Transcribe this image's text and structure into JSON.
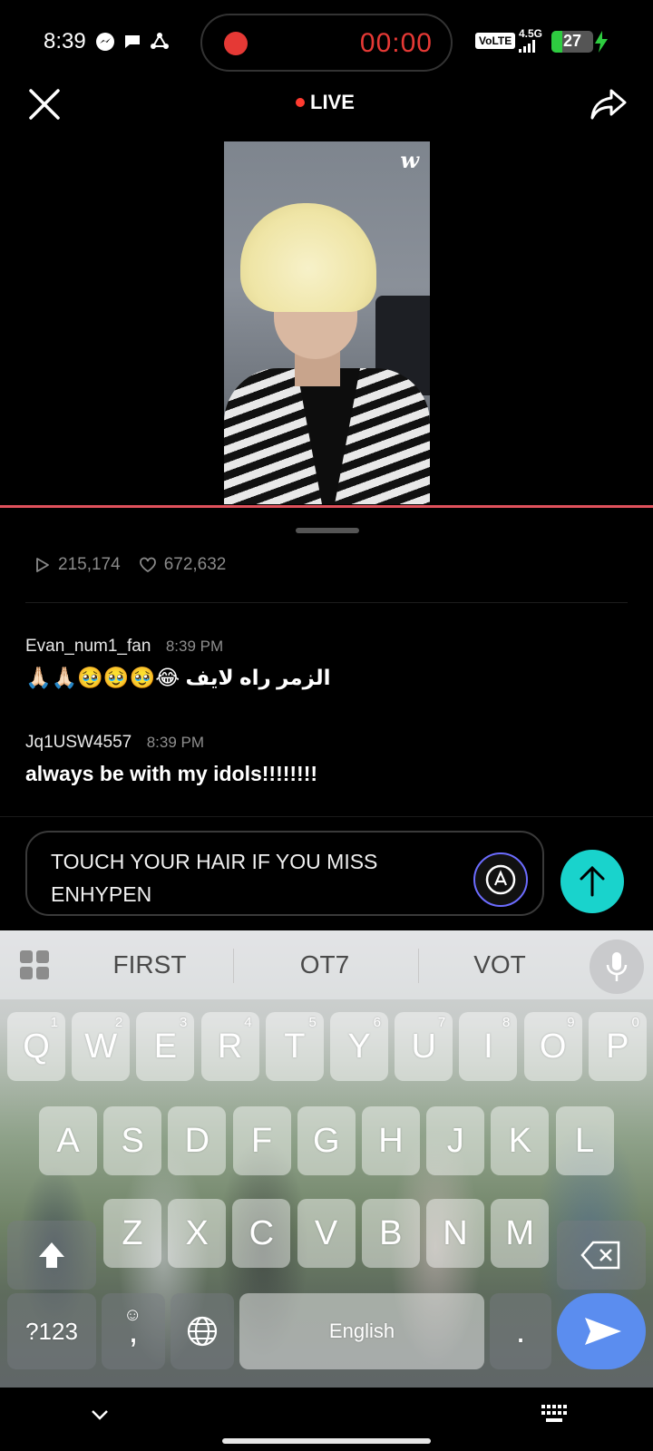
{
  "status_bar": {
    "time": "8:39",
    "recording_time": "00:00",
    "volte": "VoLTE",
    "network": "4.5G",
    "battery": "27",
    "battery_level": 0.27
  },
  "header": {
    "live_label": "LIVE"
  },
  "video": {
    "logo": "w"
  },
  "stats": {
    "plays": "215,174",
    "likes": "672,632"
  },
  "comments": [
    {
      "user": "Evan_num1_fan",
      "time": "8:39 PM",
      "text": "الزمر راه لايف 😂🥹🥹🥹🙏🏻🙏🏻"
    },
    {
      "user": "Jq1USW4557",
      "time": "8:39 PM",
      "text": "always be with my idols!!!!!!!!"
    }
  ],
  "input": {
    "value": "TOUCH YOUR HAIR IF YOU MISS ENHYPEN"
  },
  "keyboard": {
    "suggestions": [
      "FIRST",
      "OT7",
      "VOT"
    ],
    "row1": [
      {
        "k": "Q",
        "h": "1"
      },
      {
        "k": "W",
        "h": "2"
      },
      {
        "k": "E",
        "h": "3"
      },
      {
        "k": "R",
        "h": "4"
      },
      {
        "k": "T",
        "h": "5"
      },
      {
        "k": "Y",
        "h": "6"
      },
      {
        "k": "U",
        "h": "7"
      },
      {
        "k": "I",
        "h": "8"
      },
      {
        "k": "O",
        "h": "9"
      },
      {
        "k": "P",
        "h": "0"
      }
    ],
    "row2": [
      "A",
      "S",
      "D",
      "F",
      "G",
      "H",
      "J",
      "K",
      "L"
    ],
    "row3": [
      "Z",
      "X",
      "C",
      "V",
      "B",
      "N",
      "M"
    ],
    "symbols_key": "?123",
    "comma_key": ",",
    "space_label": "English",
    "period_key": "."
  },
  "colors": {
    "accent_red": "#e53935",
    "send_teal": "#19d3cc",
    "enter_blue": "#5b8def"
  }
}
